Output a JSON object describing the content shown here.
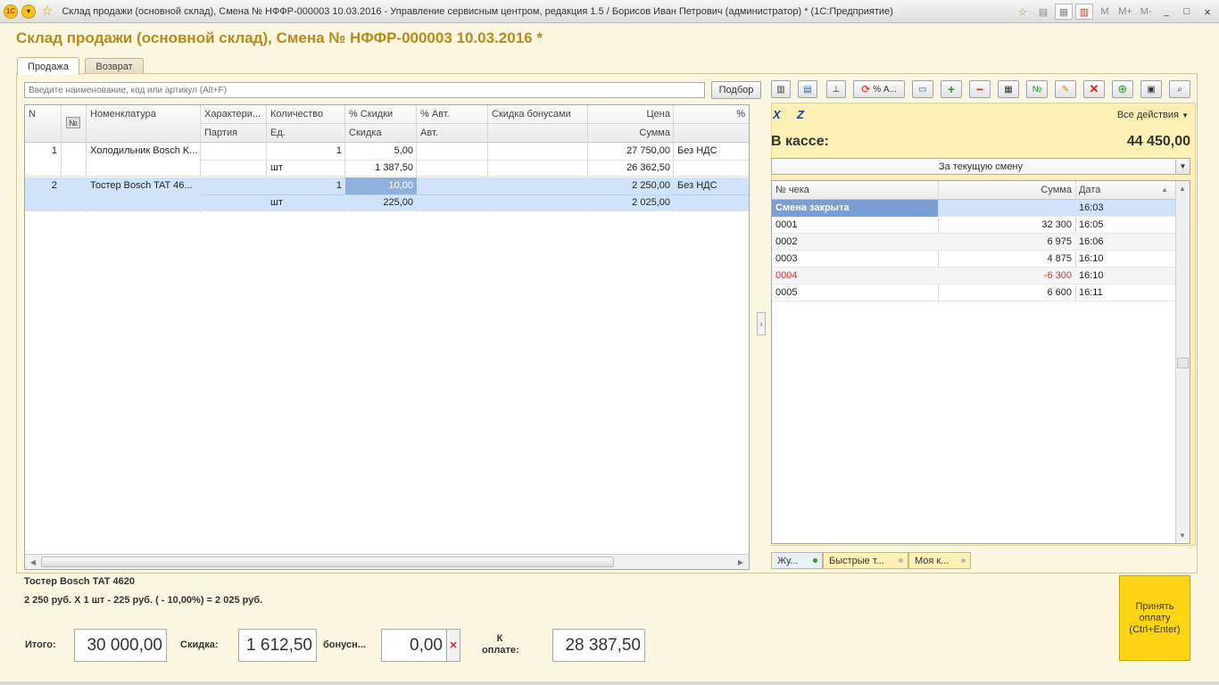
{
  "window": {
    "title": "Склад продажи (основной склад), Смена № НФФР-000003  10.03.2016 - Управление сервисным центром, редакция 1.5 / Борисов Иван Петрович (администратор) * (1С:Предприятие)",
    "right_buttons": [
      "M",
      "M+",
      "M-",
      "_",
      "□",
      "×"
    ]
  },
  "form": {
    "title": "Склад продажи (основной склад), Смена № НФФР-000003  10.03.2016 *"
  },
  "tabs": {
    "sale": "Продажа",
    "return": "Возврат"
  },
  "search": {
    "placeholder": "Введите наименование, код или артикул (Alt+F)"
  },
  "buttons": {
    "podbor": "Подбор",
    "all_actions": "Все действия",
    "percent_a": "% А...",
    "pay": "Принять оплату (Ctrl+Enter)"
  },
  "table": {
    "headers": {
      "n": "N",
      "no_icon": "№",
      "nomenclature": "Номенклатура",
      "characteristic": "Характери...",
      "batch": "Партия",
      "quantity": "Количество",
      "unit": "Ед.",
      "disc_pct": "% Скидки",
      "discount": "Скидка",
      "auto_pct": "% Авт.",
      "auto": "Авт.",
      "bonus_discount": "Скидка бонусами",
      "price": "Цена",
      "sum": "Сумма",
      "vat_pct": "%"
    },
    "rows": [
      {
        "n": "1",
        "name": "Холодильник Bosch K...",
        "qty": "1",
        "unit": "шт",
        "disc_pct": "5,00",
        "discount": "1 387,50",
        "price": "27 750,00",
        "sum": "26 362,50",
        "vat": "Без НДС"
      },
      {
        "n": "2",
        "name": "Тостер Bosch TAT 46...",
        "qty": "1",
        "unit": "шт",
        "disc_pct": "10,00",
        "discount": "225,00",
        "price": "2 250,00",
        "sum": "2 025,00",
        "vat": "Без НДС"
      }
    ]
  },
  "cash": {
    "label": "В кассе:",
    "value": "44 450,00",
    "period": "За текущую смену",
    "headers": {
      "check": "№ чека",
      "sum": "Сумма",
      "date": "Дата"
    },
    "rows": [
      {
        "check": "Смена закрыта",
        "sum": "",
        "time": "16:03"
      },
      {
        "check": "0001",
        "sum": "32 300",
        "time": "16:05"
      },
      {
        "check": "0002",
        "sum": "6 975",
        "time": "16:06"
      },
      {
        "check": "0003",
        "sum": "4 875",
        "time": "16:10"
      },
      {
        "check": "0004",
        "sum": "-6 300",
        "time": "16:10"
      },
      {
        "check": "0005",
        "sum": "6 600",
        "time": "16:11"
      }
    ],
    "bottom_tabs": [
      "Жу...",
      "Быстрые т...",
      "Моя к..."
    ]
  },
  "info": {
    "product": "Тостер Bosch TAT 4620",
    "calc": "2 250 руб. Х 1 шт - 225 руб. ( - 10,00%) = 2 025 руб."
  },
  "totals": {
    "total_label": "Итого:",
    "total": "30 000,00",
    "discount_label": "Скидка:",
    "discount": "1 612,50",
    "bonus_label": "бонусн...",
    "bonus": "0,00",
    "topay_label": "К оплате:",
    "topay": "28 387,50"
  },
  "colors": {
    "accent": "#b88a1a",
    "highlight": "#ffd413",
    "selection": "#cfe4fb",
    "negative": "#e0302a"
  }
}
